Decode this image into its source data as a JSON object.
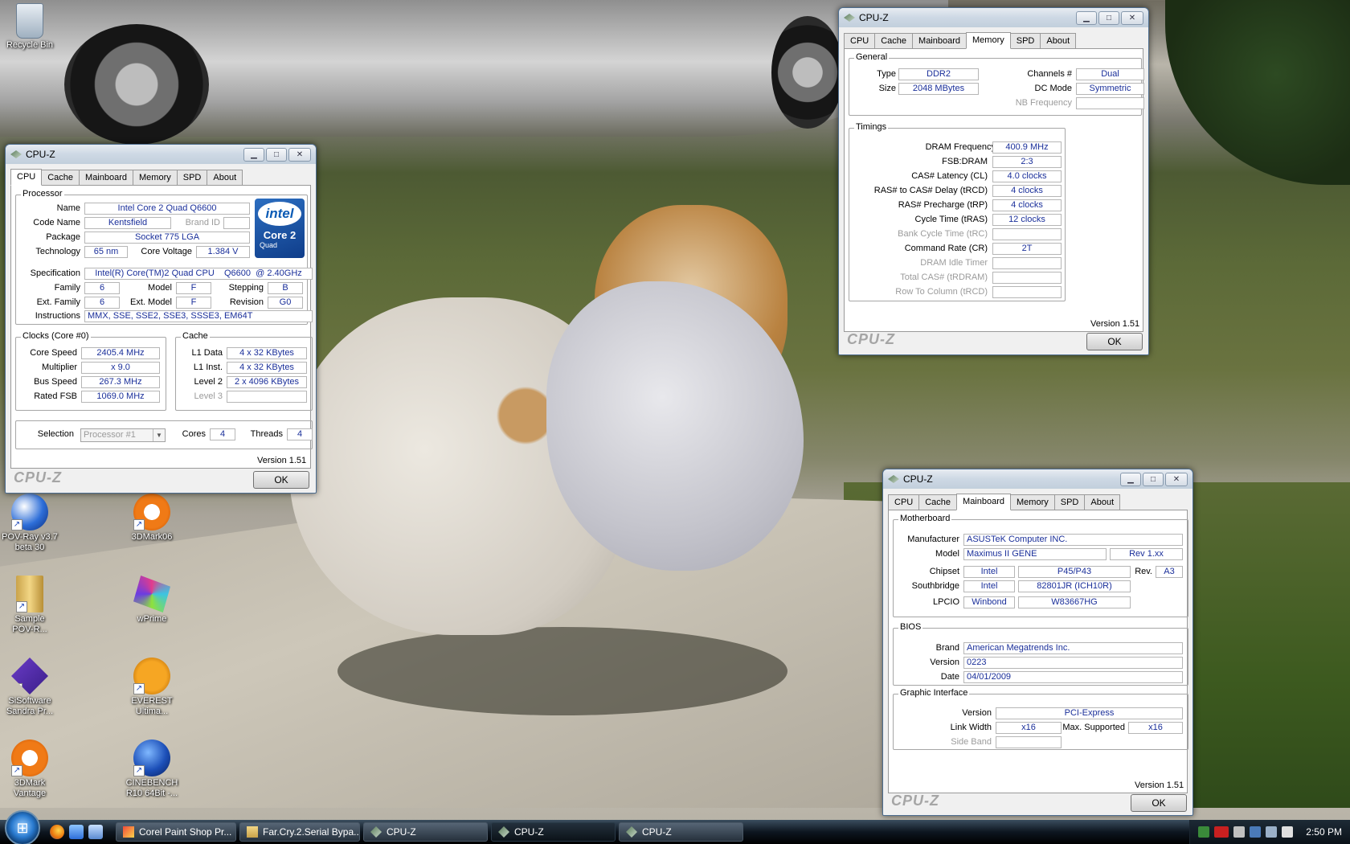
{
  "desktop": {
    "icons": [
      {
        "label": "Recycle Bin",
        "icon": "recycle-bin-icon"
      },
      {
        "label": "POV-Ray v3.7\nbeta 30",
        "icon": "povray-icon"
      },
      {
        "label": "3DMark06",
        "icon": "3dmark06-icon"
      },
      {
        "label": "Sample\nPOV-R...",
        "icon": "folder-icon"
      },
      {
        "label": "wPrime",
        "icon": "wprime-icon"
      },
      {
        "label": "SiSoftware\nSandra Pr...",
        "icon": "sandra-icon"
      },
      {
        "label": "EVEREST\nUltima...",
        "icon": "everest-icon"
      },
      {
        "label": "3DMark\nVantage",
        "icon": "3dmark-vantage-icon"
      },
      {
        "label": "CINEBENCH\nR10 64Bit -...",
        "icon": "cinebench-icon"
      }
    ]
  },
  "common": {
    "title": "CPU-Z",
    "tabs": [
      "CPU",
      "Cache",
      "Mainboard",
      "Memory",
      "SPD",
      "About"
    ],
    "brand": "CPU-Z",
    "version": "Version 1.51",
    "ok": "OK"
  },
  "cpu_window": {
    "active_tab": "CPU",
    "processor_group": "Processor",
    "name_label": "Name",
    "name": "Intel Core 2 Quad Q6600",
    "codename_label": "Code Name",
    "codename": "Kentsfield",
    "brandid_label": "Brand ID",
    "package_label": "Package",
    "package": "Socket 775 LGA",
    "technology_label": "Technology",
    "technology": "65 nm",
    "voltage_label": "Core Voltage",
    "voltage": "1.384 V",
    "spec_label": "Specification",
    "spec": "Intel(R) Core(TM)2 Quad CPU    Q6600  @ 2.40GHz",
    "family_label": "Family",
    "family": "6",
    "model_label": "Model",
    "model": "F",
    "stepping_label": "Stepping",
    "stepping": "B",
    "extfamily_label": "Ext. Family",
    "extfamily": "6",
    "extmodel_label": "Ext. Model",
    "extmodel": "F",
    "revision_label": "Revision",
    "revision": "G0",
    "instructions_label": "Instructions",
    "instructions": "MMX, SSE, SSE2, SSE3, SSSE3, EM64T",
    "clocks_group": "Clocks (Core #0)",
    "corespeed_label": "Core Speed",
    "corespeed": "2405.4 MHz",
    "multiplier_label": "Multiplier",
    "multiplier": "x 9.0",
    "busspeed_label": "Bus Speed",
    "busspeed": "267.3 MHz",
    "ratedfsb_label": "Rated FSB",
    "ratedfsb": "1069.0 MHz",
    "cache_group": "Cache",
    "l1data_label": "L1 Data",
    "l1data": "4 x 32 KBytes",
    "l1inst_label": "L1 Inst.",
    "l1inst": "4 x 32 KBytes",
    "level2_label": "Level 2",
    "level2": "2 x 4096 KBytes",
    "level3_label": "Level 3",
    "selection_label": "Selection",
    "selection": "Processor #1",
    "cores_label": "Cores",
    "cores": "4",
    "threads_label": "Threads",
    "threads": "4",
    "intel_logo": "intel",
    "intel_product": "Core 2",
    "intel_sub": "Quad",
    "intel_inside": "inside"
  },
  "memory_window": {
    "active_tab": "Memory",
    "general_group": "General",
    "type_label": "Type",
    "type": "DDR2",
    "size_label": "Size",
    "size": "2048 MBytes",
    "channels_label": "Channels #",
    "channels": "Dual",
    "dcmode_label": "DC Mode",
    "dcmode": "Symmetric",
    "nbfreq_label": "NB Frequency",
    "timings_group": "Timings",
    "dramfreq_label": "DRAM Frequency",
    "dramfreq": "400.9 MHz",
    "fsbdram_label": "FSB:DRAM",
    "fsbdram": "2:3",
    "cas_label": "CAS# Latency (CL)",
    "cas": "4.0 clocks",
    "trcd_label": "RAS# to CAS# Delay (tRCD)",
    "trcd": "4 clocks",
    "trp_label": "RAS# Precharge (tRP)",
    "trp": "4 clocks",
    "tras_label": "Cycle Time (tRAS)",
    "tras": "12 clocks",
    "trc_label": "Bank Cycle Time (tRC)",
    "cr_label": "Command Rate (CR)",
    "cr": "2T",
    "idle_label": "DRAM Idle Timer",
    "trdram_label": "Total CAS# (tRDRAM)",
    "rtc_label": "Row To Column (tRCD)"
  },
  "mainboard_window": {
    "active_tab": "Mainboard",
    "mb_group": "Motherboard",
    "manufacturer_label": "Manufacturer",
    "manufacturer": "ASUSTeK Computer INC.",
    "model_label": "Model",
    "model": "Maximus II GENE",
    "model_rev": "Rev 1.xx",
    "chipset_label": "Chipset",
    "chipset_vendor": "Intel",
    "chipset": "P45/P43",
    "rev_label": "Rev.",
    "rev": "A3",
    "southbridge_label": "Southbridge",
    "southbridge_vendor": "Intel",
    "southbridge": "82801JR (ICH10R)",
    "lpcio_label": "LPCIO",
    "lpcio_vendor": "Winbond",
    "lpcio": "W83667HG",
    "bios_group": "BIOS",
    "brand_label": "Brand",
    "brand": "American Megatrends Inc.",
    "version_label": "Version",
    "version": "0223",
    "date_label": "Date",
    "date": "04/01/2009",
    "gi_group": "Graphic Interface",
    "gi_version_label": "Version",
    "gi_version": "PCI-Express",
    "linkwidth_label": "Link Width",
    "linkwidth": "x16",
    "maxsupported_label": "Max. Supported",
    "maxsupported": "x16",
    "sideband_label": "Side Band"
  },
  "taskbar": {
    "items": [
      {
        "label": "Corel Paint Shop Pr..."
      },
      {
        "label": "Far.Cry.2.Serial Bypa..."
      },
      {
        "label": "CPU-Z"
      },
      {
        "label": "CPU-Z"
      },
      {
        "label": "CPU-Z"
      }
    ],
    "clock": "2:50 PM"
  },
  "colors": {
    "value_text": "#1a2f9a",
    "accent": "#2c6ec0"
  }
}
